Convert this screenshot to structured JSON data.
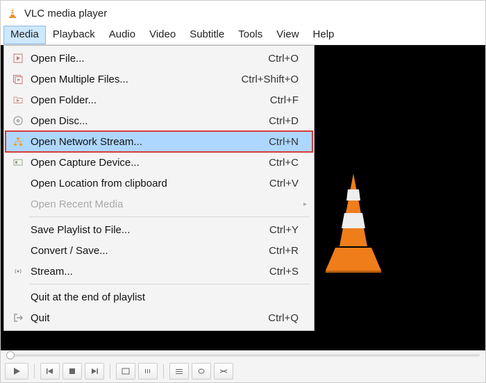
{
  "app": {
    "title": "VLC media player"
  },
  "menubar": {
    "items": [
      {
        "label": "Media",
        "open": true
      },
      {
        "label": "Playback"
      },
      {
        "label": "Audio"
      },
      {
        "label": "Video"
      },
      {
        "label": "Subtitle"
      },
      {
        "label": "Tools"
      },
      {
        "label": "View"
      },
      {
        "label": "Help"
      }
    ]
  },
  "menu": {
    "open_file": {
      "label": "Open File...",
      "shortcut": "Ctrl+O"
    },
    "open_multiple": {
      "label": "Open Multiple Files...",
      "shortcut": "Ctrl+Shift+O"
    },
    "open_folder": {
      "label": "Open Folder...",
      "shortcut": "Ctrl+F"
    },
    "open_disc": {
      "label": "Open Disc...",
      "shortcut": "Ctrl+D"
    },
    "open_network": {
      "label": "Open Network Stream...",
      "shortcut": "Ctrl+N"
    },
    "open_capture": {
      "label": "Open Capture Device...",
      "shortcut": "Ctrl+C"
    },
    "open_clipboard": {
      "label": "Open Location from clipboard",
      "shortcut": "Ctrl+V"
    },
    "open_recent": {
      "label": "Open Recent Media"
    },
    "save_playlist": {
      "label": "Save Playlist to File...",
      "shortcut": "Ctrl+Y"
    },
    "convert_save": {
      "label": "Convert / Save...",
      "shortcut": "Ctrl+R"
    },
    "stream": {
      "label": "Stream...",
      "shortcut": "Ctrl+S"
    },
    "quit_end": {
      "label": "Quit at the end of playlist"
    },
    "quit": {
      "label": "Quit",
      "shortcut": "Ctrl+Q"
    }
  }
}
